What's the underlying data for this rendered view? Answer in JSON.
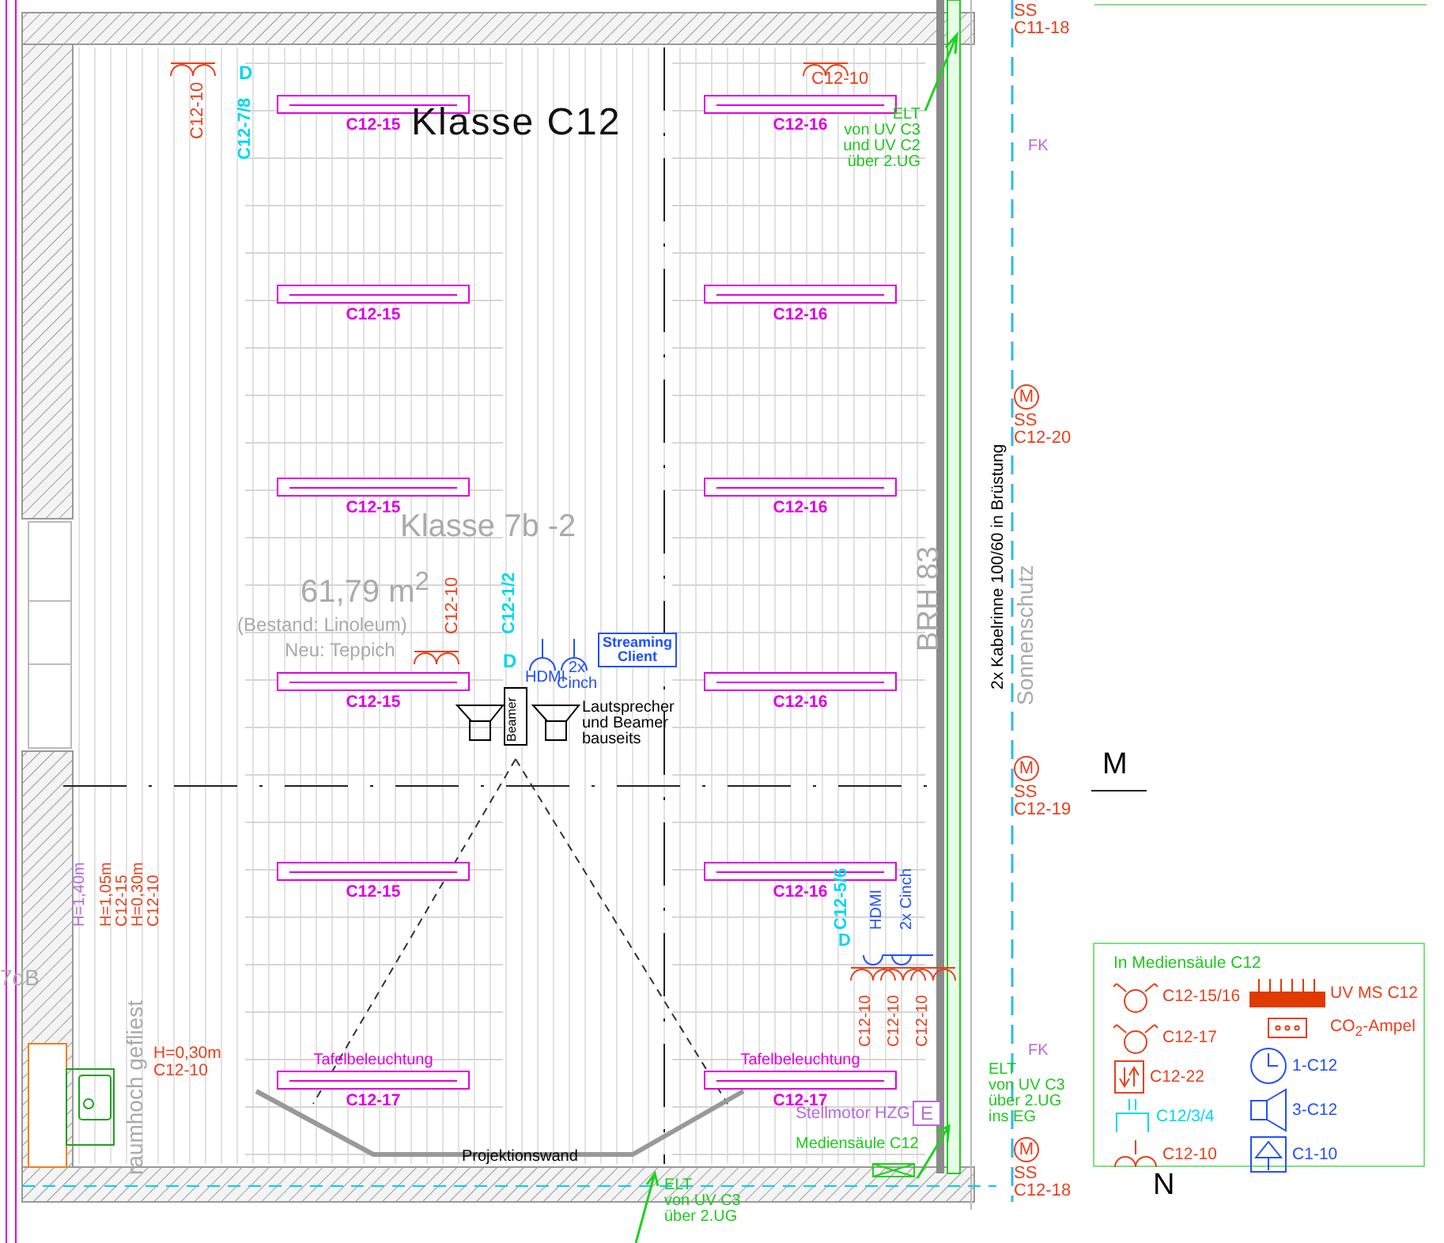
{
  "room": {
    "name": "Klasse C12",
    "former_name": "Klasse 7b -2",
    "area": "61,79 m$^{2}$",
    "floor_existing": "(Bestand: Linoleum)",
    "floor_new": "Neu: Teppich"
  },
  "luminaires": [
    {
      "label": "C12-15"
    },
    {
      "label": "C12-15"
    },
    {
      "label": "C12-15"
    },
    {
      "label": "C12-15"
    },
    {
      "label": "C12-15"
    },
    {
      "label": "C12-17",
      "caption": "Tafelbeleuchtung"
    },
    {
      "label": "C12-16"
    },
    {
      "label": "C12-16"
    },
    {
      "label": "C12-16"
    },
    {
      "label": "C12-16"
    },
    {
      "label": "C12-16"
    },
    {
      "label": "C12-17",
      "caption": "Tafelbeleuchtung"
    }
  ],
  "annotations": [
    {
      "kind": "power",
      "text": "C12-10"
    },
    {
      "kind": "data",
      "text": "C12-7/8"
    },
    {
      "kind": "data",
      "text": "D"
    },
    {
      "kind": "power",
      "text": "C12-10"
    },
    {
      "kind": "supply",
      "text": "ELT\nvon UV C3\nund UV C2\nüber 2.UG"
    },
    {
      "kind": "power",
      "text": "SS\nC11-18"
    },
    {
      "kind": "hvac",
      "text": "FK"
    },
    {
      "kind": "motor",
      "text": "M"
    },
    {
      "kind": "power",
      "text": "SS\nC12-20"
    },
    {
      "kind": "note",
      "text": "2x Kabelrinne 100/60 in Brüstung"
    },
    {
      "kind": "ghost",
      "text": "Sonnenschutz"
    },
    {
      "kind": "ghost",
      "text": "BRH 83"
    },
    {
      "kind": "axis",
      "text": "M"
    },
    {
      "kind": "motor",
      "text": "M"
    },
    {
      "kind": "power",
      "text": "SS\nC12-19"
    },
    {
      "kind": "power",
      "text": "C12-10"
    },
    {
      "kind": "data",
      "text": "C12-1/2"
    },
    {
      "kind": "data",
      "text": "D"
    },
    {
      "kind": "media",
      "text": "HDMI"
    },
    {
      "kind": "media",
      "text": "2x\nCinch"
    },
    {
      "kind": "media_box",
      "text": "Streaming\nClient"
    },
    {
      "kind": "note",
      "text": "Beamer"
    },
    {
      "kind": "note",
      "text": "Lautsprecher\nund Beamer\nbauseits"
    },
    {
      "kind": "hvac",
      "text": "H=1,40m"
    },
    {
      "kind": "power",
      "text": "H=1,05m\nC12-15\nH=0,30m\nC12-10"
    },
    {
      "kind": "ghost",
      "text": "7dB"
    },
    {
      "kind": "ghost",
      "text": "raumhoch gefliest"
    },
    {
      "kind": "power",
      "text": "H=0,30m\nC12-10"
    },
    {
      "kind": "note",
      "text": "Projektionswand"
    },
    {
      "kind": "data",
      "text": "C12-5/6"
    },
    {
      "kind": "data",
      "text": "D"
    },
    {
      "kind": "media",
      "text": "HDMI"
    },
    {
      "kind": "media",
      "text": "2x Cinch"
    },
    {
      "kind": "power",
      "text": "C12-10"
    },
    {
      "kind": "power",
      "text": "C12-10"
    },
    {
      "kind": "power",
      "text": "C12-10"
    },
    {
      "kind": "supply",
      "text": "ELT\nvon UV C3\nüber 2.UG\nins EG"
    },
    {
      "kind": "hvac",
      "text": "FK"
    },
    {
      "kind": "hvac",
      "text": "Stellmotor HZG"
    },
    {
      "kind": "hvac_box",
      "text": "E"
    },
    {
      "kind": "supply",
      "text": "Mediensäule C12"
    },
    {
      "kind": "motor",
      "text": "M"
    },
    {
      "kind": "power",
      "text": "SS\nC12-18"
    },
    {
      "kind": "supply",
      "text": "ELT\nvon UV C3\nüber 2.UG"
    },
    {
      "kind": "axis",
      "text": "N"
    }
  ],
  "legend": {
    "title": "In Mediensäule C12",
    "left": [
      {
        "kind": "luminaire",
        "text": "C12-15/16"
      },
      {
        "kind": "luminaire",
        "text": "C12-17"
      },
      {
        "kind": "switch",
        "text": "C12-22"
      },
      {
        "kind": "data",
        "text": "C12/3/4"
      },
      {
        "kind": "socket",
        "text": "C12-10"
      }
    ],
    "right": [
      {
        "kind": "panel",
        "text": "UV MS C12"
      },
      {
        "kind": "co2",
        "text": "CO$_{2}$-Ampel"
      },
      {
        "kind": "clock",
        "text": "1-C12"
      },
      {
        "kind": "speaker",
        "text": "3-C12"
      },
      {
        "kind": "alarm",
        "text": "C1-10"
      }
    ]
  }
}
